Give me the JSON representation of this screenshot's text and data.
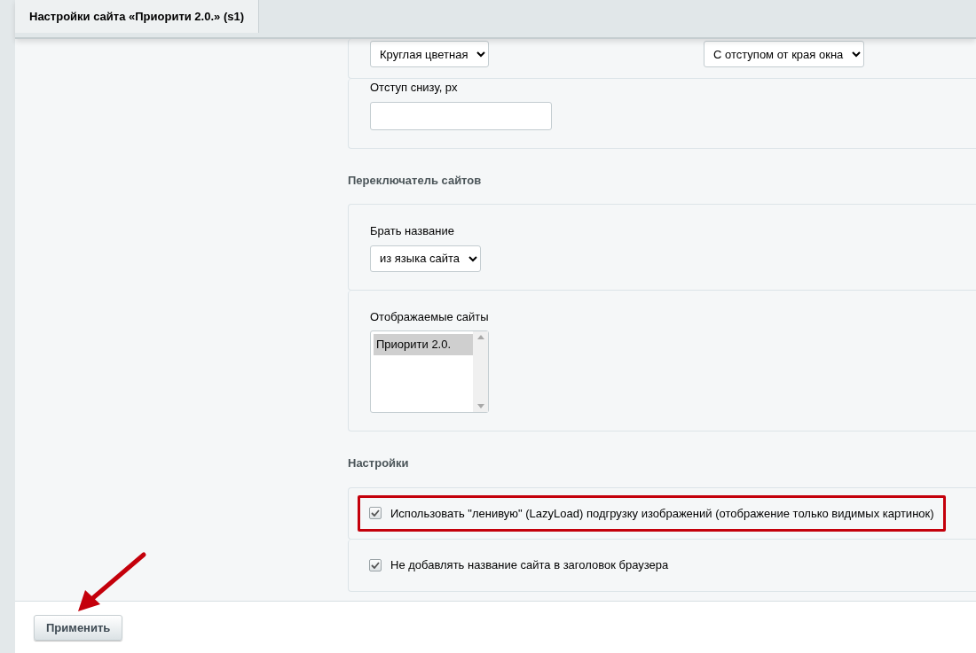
{
  "tabs": [
    {
      "label": "Настройки сайта «Приорити 2.0.» (s1)",
      "selected": true
    }
  ],
  "sections": [
    {
      "panels": [
        {
          "kind": "select-pair",
          "selects": [
            {
              "value": "Круглая цветная"
            },
            {
              "value": "С отступом от края окна"
            }
          ]
        },
        {
          "kind": "input",
          "label": "Отступ снизу, px"
        }
      ]
    },
    {
      "title": "Переключатель сайтов",
      "panels": [
        {
          "kind": "select",
          "label": "Брать название",
          "value": "из языка сайта"
        },
        {
          "kind": "listbox",
          "label": "Отображаемые сайты",
          "options": [
            {
              "label": "Приорити 2.0.",
              "selected": true
            }
          ]
        }
      ]
    },
    {
      "title": "Настройки",
      "panels": [
        {
          "kind": "checkbox",
          "label": "Использовать \"ленивую\" (LazyLoad) подгрузку изображений (отображение только видимых картинок)",
          "checked": true,
          "highlighted": true
        },
        {
          "kind": "checkbox",
          "label": "Не добавлять название сайта в заголовок браузера",
          "checked": true,
          "highlighted": false
        }
      ]
    }
  ],
  "apply_button": "Применить"
}
